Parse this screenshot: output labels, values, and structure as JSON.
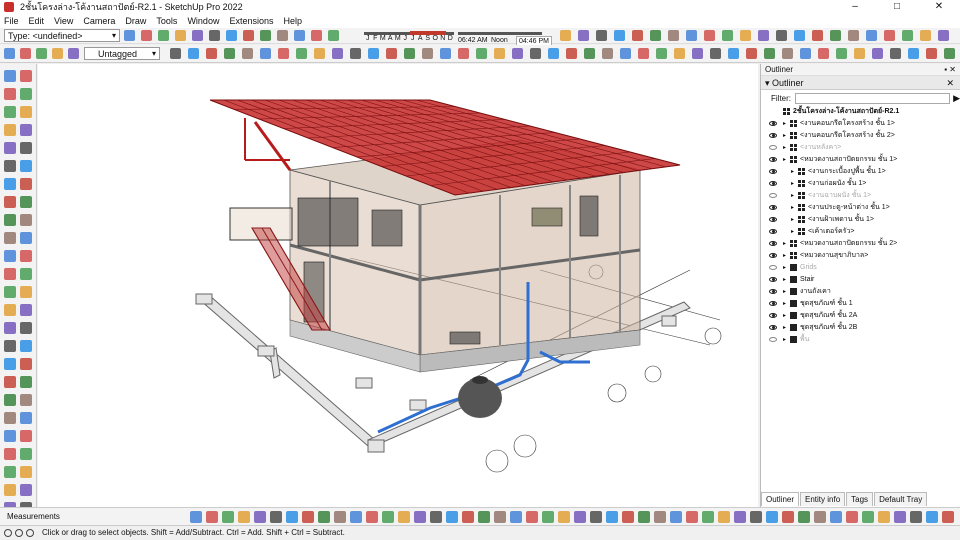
{
  "window": {
    "title": "2ชั้นโครงล่าง-โค้งานสถาปัตย์-R2.1 - SketchUp Pro 2022",
    "controls": [
      "–",
      "□",
      "✕"
    ]
  },
  "menu": [
    "File",
    "Edit",
    "View",
    "Camera",
    "Draw",
    "Tools",
    "Window",
    "Extensions",
    "Help"
  ],
  "toolbar": {
    "type_label": "Type: <undefined>",
    "tag_label": "Untagged",
    "months": [
      "J",
      "F",
      "M",
      "A",
      "M",
      "J",
      "J",
      "A",
      "S",
      "O",
      "N",
      "D"
    ],
    "time_start": "06:42 AM",
    "time_noon": "Noon",
    "time_end": "04:46 PM"
  },
  "outliner": {
    "panel_title": "Outliner",
    "tray_title": "Outliner",
    "filter_label": "Filter:",
    "root": "2ชั้นโครงล่าง-โค้งานสถาปัตย์-R2.1",
    "items": [
      {
        "label": "<งานคอนกรีตโครงสร้าง ชั้น 1>",
        "visible": true,
        "level": 1,
        "type": "component"
      },
      {
        "label": "<งานคอนกรีตโครงสร้าง ชั้น 2>",
        "visible": true,
        "level": 1,
        "type": "component"
      },
      {
        "label": "<งานหลังคา>",
        "visible": false,
        "level": 1,
        "type": "component"
      },
      {
        "label": "<หมวดงานสถาปัตยกรรม ชั้น 1>",
        "visible": true,
        "level": 1,
        "type": "component"
      },
      {
        "label": "<งานกระเบื้องปูพื้น ชั้น 1>",
        "visible": true,
        "level": 2,
        "type": "component"
      },
      {
        "label": "<งานก่อผนัง ชั้น 1>",
        "visible": true,
        "level": 2,
        "type": "component"
      },
      {
        "label": "<งานฉาบผนัง ชั้น 1>",
        "visible": false,
        "level": 2,
        "type": "component"
      },
      {
        "label": "<งานประตู-หน้าต่าง ชั้น 1>",
        "visible": true,
        "level": 2,
        "type": "component"
      },
      {
        "label": "<งานฝ้าเพดาน ชั้น 1>",
        "visible": true,
        "level": 2,
        "type": "component"
      },
      {
        "label": "<เค้าเตอร์ครัว>",
        "visible": true,
        "level": 2,
        "type": "component"
      },
      {
        "label": "<หมวดงานสถาปัตยกรรม ชั้น 2>",
        "visible": true,
        "level": 1,
        "type": "component"
      },
      {
        "label": "<หมวดงานสุขาภิบาล>",
        "visible": true,
        "level": 1,
        "type": "component"
      },
      {
        "label": "Grids",
        "visible": false,
        "level": 1,
        "type": "group"
      },
      {
        "label": "Stair",
        "visible": true,
        "level": 1,
        "type": "group"
      },
      {
        "label": "งานถังเคา",
        "visible": true,
        "level": 1,
        "type": "group"
      },
      {
        "label": "ชุดสุขภัณฑ์ ชั้น 1",
        "visible": true,
        "level": 1,
        "type": "group"
      },
      {
        "label": "ชุดสุขภัณฑ์ ชั้น 2A",
        "visible": true,
        "level": 1,
        "type": "group"
      },
      {
        "label": "ชุดสุขภัณฑ์ ชั้น 2B",
        "visible": true,
        "level": 1,
        "type": "group"
      },
      {
        "label": "พื้น",
        "visible": false,
        "level": 1,
        "type": "group"
      }
    ]
  },
  "tray_tabs": [
    "Outliner",
    "Entity info",
    "Tags",
    "Default Tray"
  ],
  "measurements_label": "Measurements",
  "status_text": "Click or drag to select objects. Shift = Add/Subtract. Ctrl = Add. Shift + Ctrl = Subtract.",
  "colors": {
    "roof_red": "#c62828",
    "pipe_blue": "#2e6fd1",
    "accent": "#1e88e5"
  }
}
